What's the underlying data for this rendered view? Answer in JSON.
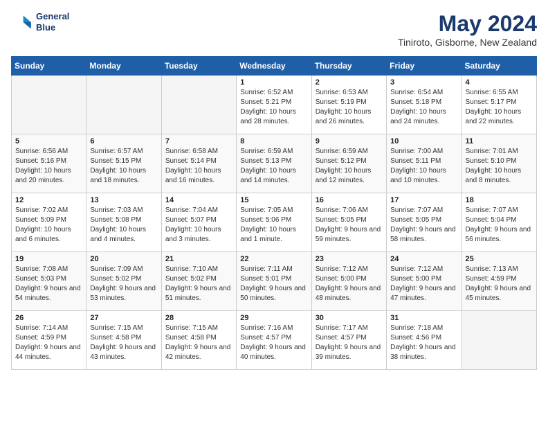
{
  "header": {
    "logo_line1": "General",
    "logo_line2": "Blue",
    "month_title": "May 2024",
    "location": "Tiniroto, Gisborne, New Zealand"
  },
  "days_of_week": [
    "Sunday",
    "Monday",
    "Tuesday",
    "Wednesday",
    "Thursday",
    "Friday",
    "Saturday"
  ],
  "weeks": [
    [
      {
        "num": "",
        "empty": true
      },
      {
        "num": "",
        "empty": true
      },
      {
        "num": "",
        "empty": true
      },
      {
        "num": "1",
        "sunrise": "6:52 AM",
        "sunset": "5:21 PM",
        "daylight": "10 hours and 28 minutes."
      },
      {
        "num": "2",
        "sunrise": "6:53 AM",
        "sunset": "5:19 PM",
        "daylight": "10 hours and 26 minutes."
      },
      {
        "num": "3",
        "sunrise": "6:54 AM",
        "sunset": "5:18 PM",
        "daylight": "10 hours and 24 minutes."
      },
      {
        "num": "4",
        "sunrise": "6:55 AM",
        "sunset": "5:17 PM",
        "daylight": "10 hours and 22 minutes."
      }
    ],
    [
      {
        "num": "5",
        "sunrise": "6:56 AM",
        "sunset": "5:16 PM",
        "daylight": "10 hours and 20 minutes."
      },
      {
        "num": "6",
        "sunrise": "6:57 AM",
        "sunset": "5:15 PM",
        "daylight": "10 hours and 18 minutes."
      },
      {
        "num": "7",
        "sunrise": "6:58 AM",
        "sunset": "5:14 PM",
        "daylight": "10 hours and 16 minutes."
      },
      {
        "num": "8",
        "sunrise": "6:59 AM",
        "sunset": "5:13 PM",
        "daylight": "10 hours and 14 minutes."
      },
      {
        "num": "9",
        "sunrise": "6:59 AM",
        "sunset": "5:12 PM",
        "daylight": "10 hours and 12 minutes."
      },
      {
        "num": "10",
        "sunrise": "7:00 AM",
        "sunset": "5:11 PM",
        "daylight": "10 hours and 10 minutes."
      },
      {
        "num": "11",
        "sunrise": "7:01 AM",
        "sunset": "5:10 PM",
        "daylight": "10 hours and 8 minutes."
      }
    ],
    [
      {
        "num": "12",
        "sunrise": "7:02 AM",
        "sunset": "5:09 PM",
        "daylight": "10 hours and 6 minutes."
      },
      {
        "num": "13",
        "sunrise": "7:03 AM",
        "sunset": "5:08 PM",
        "daylight": "10 hours and 4 minutes."
      },
      {
        "num": "14",
        "sunrise": "7:04 AM",
        "sunset": "5:07 PM",
        "daylight": "10 hours and 3 minutes."
      },
      {
        "num": "15",
        "sunrise": "7:05 AM",
        "sunset": "5:06 PM",
        "daylight": "10 hours and 1 minute."
      },
      {
        "num": "16",
        "sunrise": "7:06 AM",
        "sunset": "5:05 PM",
        "daylight": "9 hours and 59 minutes."
      },
      {
        "num": "17",
        "sunrise": "7:07 AM",
        "sunset": "5:05 PM",
        "daylight": "9 hours and 58 minutes."
      },
      {
        "num": "18",
        "sunrise": "7:07 AM",
        "sunset": "5:04 PM",
        "daylight": "9 hours and 56 minutes."
      }
    ],
    [
      {
        "num": "19",
        "sunrise": "7:08 AM",
        "sunset": "5:03 PM",
        "daylight": "9 hours and 54 minutes."
      },
      {
        "num": "20",
        "sunrise": "7:09 AM",
        "sunset": "5:02 PM",
        "daylight": "9 hours and 53 minutes."
      },
      {
        "num": "21",
        "sunrise": "7:10 AM",
        "sunset": "5:02 PM",
        "daylight": "9 hours and 51 minutes."
      },
      {
        "num": "22",
        "sunrise": "7:11 AM",
        "sunset": "5:01 PM",
        "daylight": "9 hours and 50 minutes."
      },
      {
        "num": "23",
        "sunrise": "7:12 AM",
        "sunset": "5:00 PM",
        "daylight": "9 hours and 48 minutes."
      },
      {
        "num": "24",
        "sunrise": "7:12 AM",
        "sunset": "5:00 PM",
        "daylight": "9 hours and 47 minutes."
      },
      {
        "num": "25",
        "sunrise": "7:13 AM",
        "sunset": "4:59 PM",
        "daylight": "9 hours and 45 minutes."
      }
    ],
    [
      {
        "num": "26",
        "sunrise": "7:14 AM",
        "sunset": "4:59 PM",
        "daylight": "9 hours and 44 minutes."
      },
      {
        "num": "27",
        "sunrise": "7:15 AM",
        "sunset": "4:58 PM",
        "daylight": "9 hours and 43 minutes."
      },
      {
        "num": "28",
        "sunrise": "7:15 AM",
        "sunset": "4:58 PM",
        "daylight": "9 hours and 42 minutes."
      },
      {
        "num": "29",
        "sunrise": "7:16 AM",
        "sunset": "4:57 PM",
        "daylight": "9 hours and 40 minutes."
      },
      {
        "num": "30",
        "sunrise": "7:17 AM",
        "sunset": "4:57 PM",
        "daylight": "9 hours and 39 minutes."
      },
      {
        "num": "31",
        "sunrise": "7:18 AM",
        "sunset": "4:56 PM",
        "daylight": "9 hours and 38 minutes."
      },
      {
        "num": "",
        "empty": true
      }
    ]
  ]
}
